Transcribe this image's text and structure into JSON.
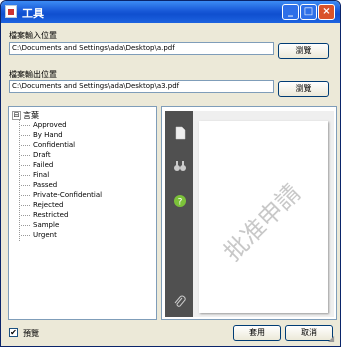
{
  "window": {
    "title": "工具"
  },
  "input_group": {
    "label": "檔案輸入位置",
    "path": "C:\\Documents and Settings\\ada\\Desktop\\a.pdf",
    "browse": "瀏覽"
  },
  "output_group": {
    "label": "檔案輸出位置",
    "path": "C:\\Documents and Settings\\ada\\Desktop\\a3.pdf",
    "browse": "瀏覽"
  },
  "tree": {
    "expander": "⊟",
    "root": "言葉",
    "items": [
      "Approved",
      "By Hand",
      "Confidential",
      "Draft",
      "Failed",
      "Final",
      "Passed",
      "Private-Confidential",
      "Rejected",
      "Restricted",
      "Sample",
      "Urgent"
    ]
  },
  "preview": {
    "stamp_text": "批准申請"
  },
  "footer": {
    "checked": true,
    "preview_label": "預覽",
    "apply": "套用",
    "cancel": "取消"
  }
}
